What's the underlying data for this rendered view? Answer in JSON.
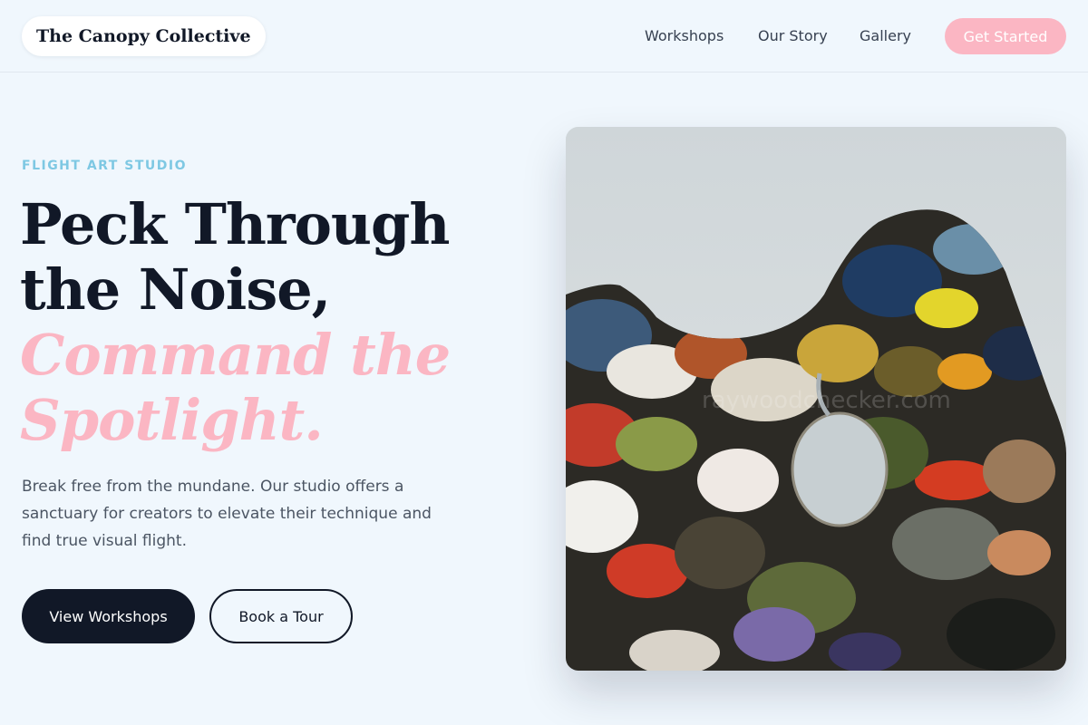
{
  "header": {
    "logo": "The Canopy Collective",
    "nav": [
      {
        "label": "Workshops"
      },
      {
        "label": "Our Story"
      },
      {
        "label": "Gallery"
      }
    ],
    "cta_label": "Get Started"
  },
  "hero": {
    "eyebrow": "FLIGHT ART STUDIO",
    "headline_line1": "Peck Through",
    "headline_line2": "the Noise,",
    "headline_accent_line1": "Command the",
    "headline_accent_line2": "Spotlight.",
    "body": "Break free from the mundane. Our studio offers a sanctuary for creators to elevate their technique and find true visual flight.",
    "primary_button": "View Workshops",
    "secondary_button": "Book a Tour"
  },
  "image": {
    "watermark": "raywoodchecker.com"
  },
  "colors": {
    "background": "#f0f7fd",
    "accent_pink": "#fbb6c3",
    "eyebrow_blue": "#7ec8e3",
    "dark": "#111827"
  }
}
